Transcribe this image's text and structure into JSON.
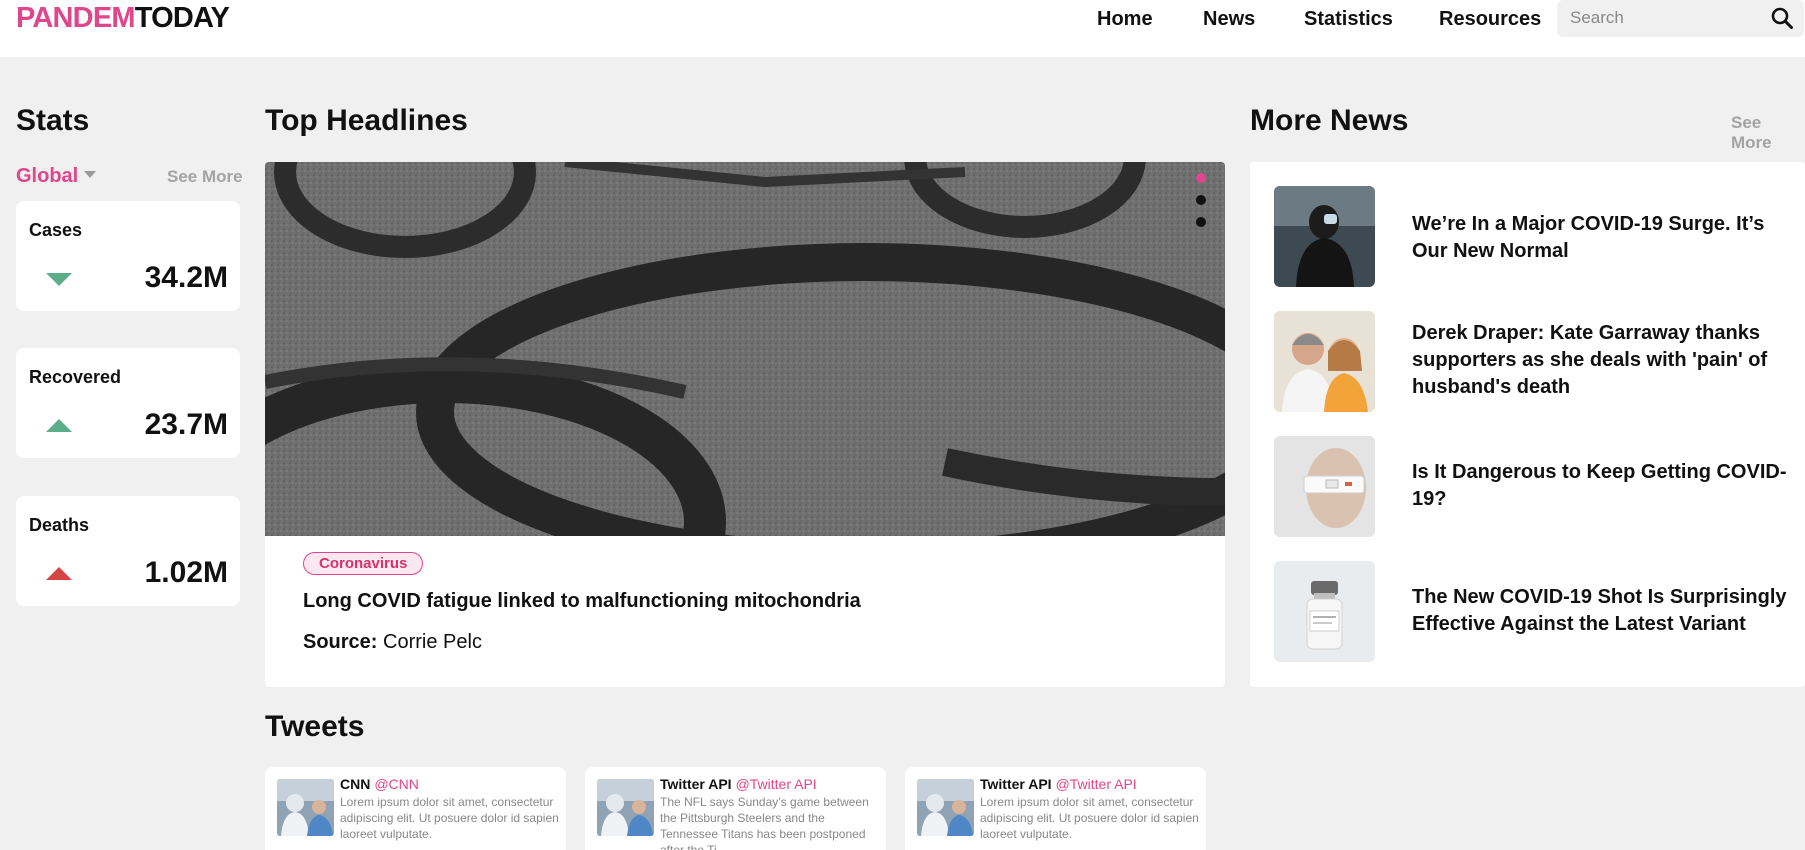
{
  "brand": {
    "logo_pink": "PANDEM",
    "logo_dark": "TODAY",
    "accent": "#e0468c"
  },
  "nav": {
    "home": "Home",
    "news": "News",
    "statistics": "Statistics",
    "resources": "Resources"
  },
  "search": {
    "placeholder": "Search",
    "icon": "search-icon"
  },
  "stats": {
    "title": "Stats",
    "region": "Global",
    "see_more": "See More",
    "cards": [
      {
        "label": "Cases",
        "value": "34.2M",
        "trend": "down",
        "trend_color": "#5cad8a"
      },
      {
        "label": "Recovered",
        "value": "23.7M",
        "trend": "up",
        "trend_color": "#5cad8a"
      },
      {
        "label": "Deaths",
        "value": "1.02M",
        "trend": "up",
        "trend_color": "#d64545"
      }
    ]
  },
  "headlines": {
    "title": "Top Headlines",
    "slide_count": 3,
    "active_slide": 1,
    "tag": "Coronavirus",
    "headline": "Long COVID fatigue linked to malfunctioning mitochondria",
    "source_label": "Source:",
    "source_name": "Corrie Pelc"
  },
  "more_news": {
    "title": "More News",
    "see_more": "See More",
    "items": [
      {
        "title": "We’re In a Major COVID-19 Surge. It’s Our New Normal"
      },
      {
        "title": "Derek Draper: Kate Garraway thanks supporters as she deals with 'pain' of husband's death"
      },
      {
        "title": "Is It Dangerous to Keep Getting COVID-19?"
      },
      {
        "title": "The New COVID-19 Shot Is Surprisingly Effective Against the Latest Variant"
      }
    ]
  },
  "tweets": {
    "title": "Tweets",
    "items": [
      {
        "name": "CNN",
        "handle": "@CNN",
        "text": "Lorem ipsum dolor sit amet, consectetur adipiscing elit. Ut posuere dolor id sapien laoreet vulputate."
      },
      {
        "name": "Twitter API",
        "handle": "@Twitter API",
        "text": "The NFL says Sunday’s game between the Pittsburgh Steelers and the Tennessee Titans has been postponed after the Ti..."
      },
      {
        "name": "Twitter API",
        "handle": "@Twitter API",
        "text": "Lorem ipsum dolor sit amet, consectetur adipiscing elit. Ut posuere dolor id sapien laoreet vulputate."
      }
    ]
  }
}
